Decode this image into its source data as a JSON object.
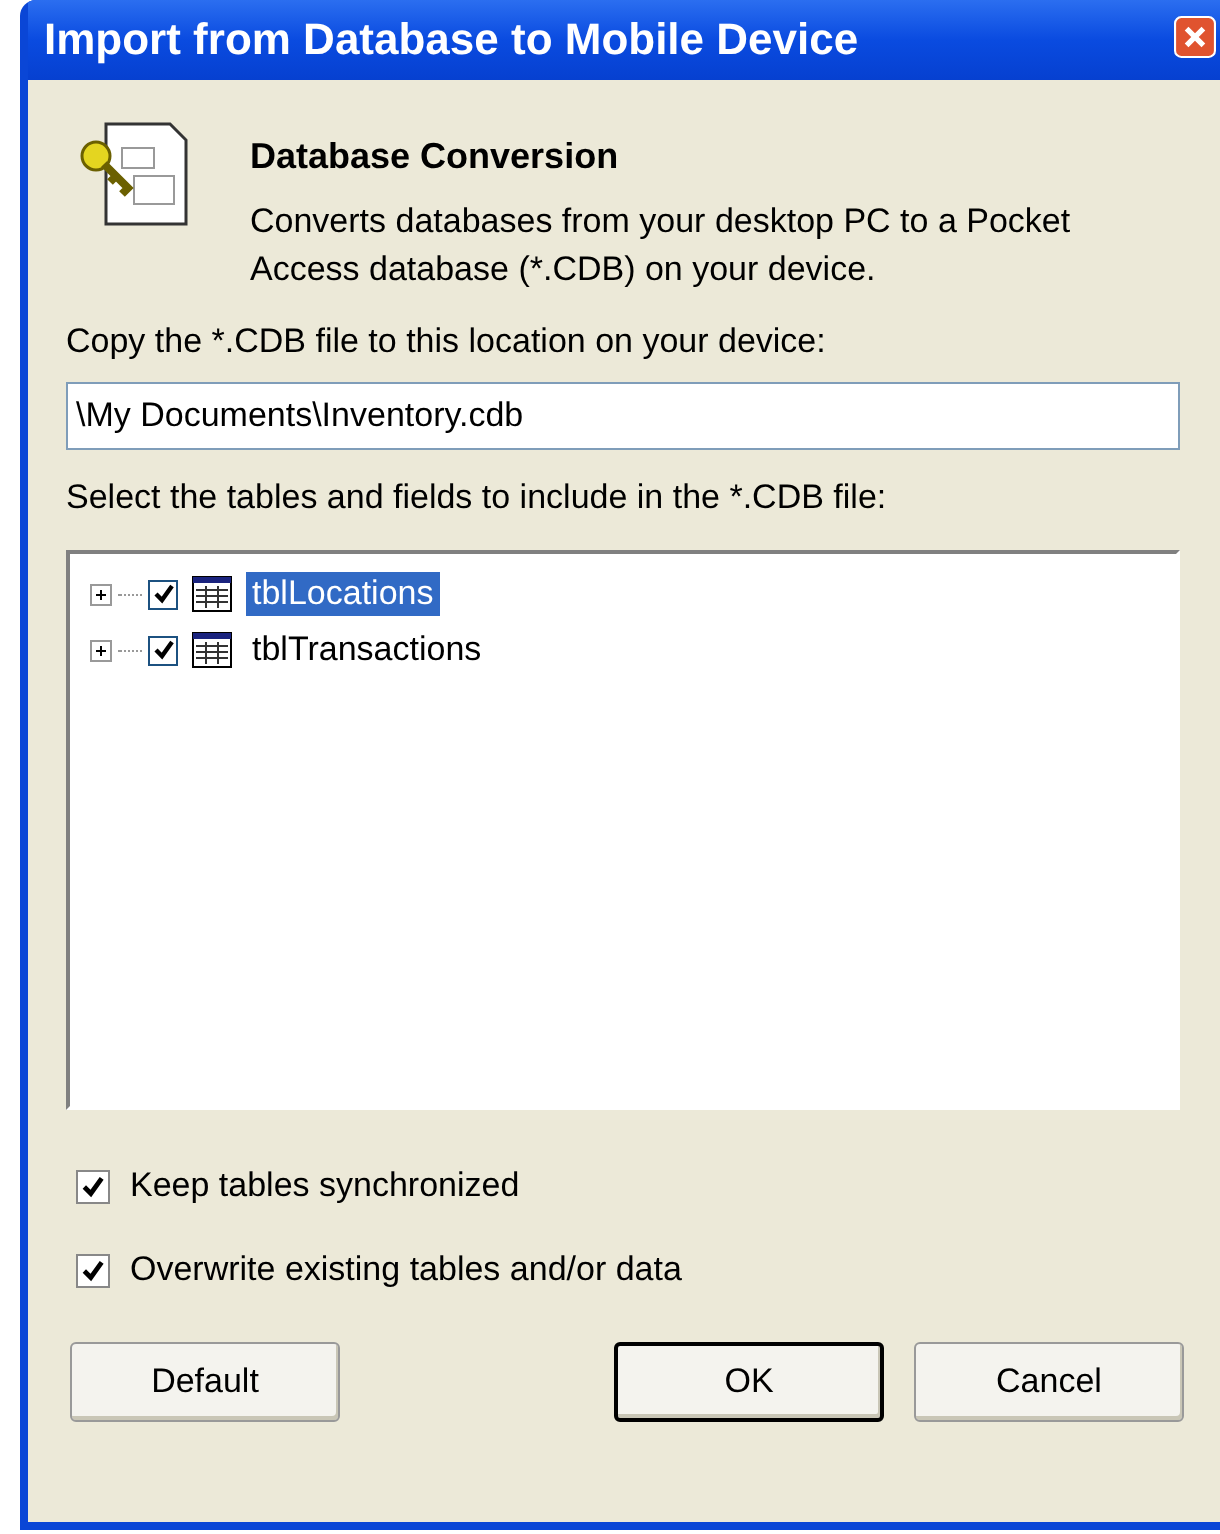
{
  "window": {
    "title": "Import from Database to Mobile Device"
  },
  "header": {
    "title": "Database Conversion",
    "description": "Converts databases from your desktop PC to a Pocket Access database (*.CDB) on your device."
  },
  "location": {
    "label": "Copy the *.CDB file to this location on your device:",
    "value": "\\My Documents\\Inventory.cdb"
  },
  "tables": {
    "label": "Select the tables and fields to include in the *.CDB file:",
    "items": [
      {
        "name": "tblLocations",
        "checked": true,
        "selected": true,
        "expanded": false
      },
      {
        "name": "tblTransactions",
        "checked": true,
        "selected": false,
        "expanded": false
      }
    ]
  },
  "options": [
    {
      "label": "Keep tables synchronized",
      "checked": true
    },
    {
      "label": "Overwrite existing tables and/or data",
      "checked": true
    }
  ],
  "buttons": [
    {
      "label": "Default",
      "is_default": false
    },
    {
      "label": "OK",
      "is_default": true
    },
    {
      "label": "Cancel",
      "is_default": false
    }
  ]
}
